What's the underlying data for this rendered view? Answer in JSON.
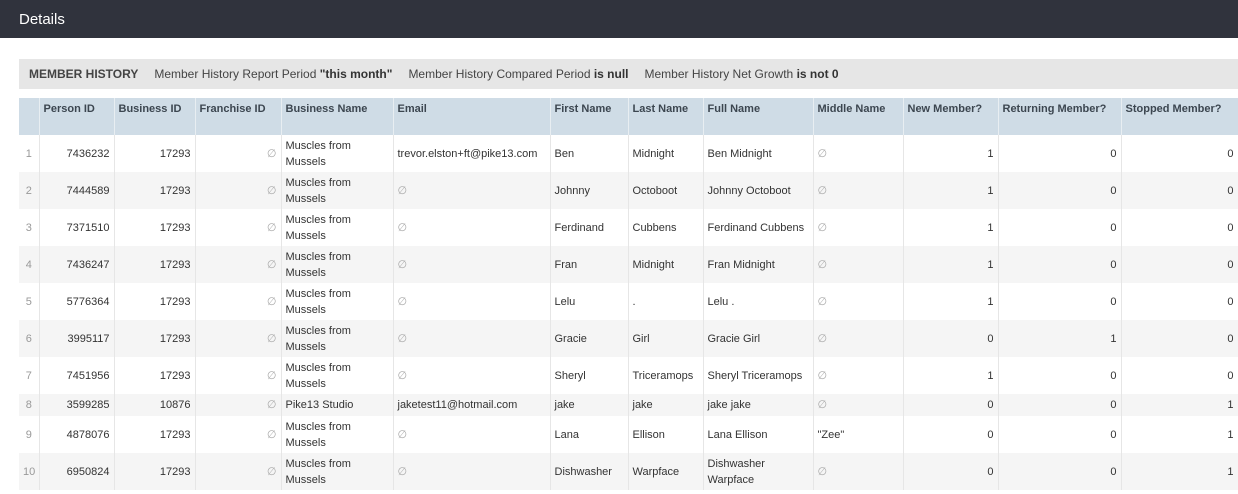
{
  "header": {
    "title": "Details"
  },
  "filters": {
    "title": "MEMBER HISTORY",
    "items": [
      {
        "label": "Member History Report Period ",
        "value": "\"this month\""
      },
      {
        "label": "Member History Compared Period ",
        "value": "is null"
      },
      {
        "label": "Member History Net Growth ",
        "value": "is not 0"
      }
    ]
  },
  "null_symbol": "∅",
  "table": {
    "columns": [
      "",
      "Person ID",
      "Business ID",
      "Franchise ID",
      "Business Name",
      "Email",
      "First Name",
      "Last Name",
      "Full Name",
      "Middle Name",
      "New Member?",
      "Returning Member?",
      "Stopped Member?"
    ],
    "rows": [
      [
        "1",
        "7436232",
        "17293",
        "∅",
        "Muscles from Mussels",
        "trevor.elston+ft@pike13.com",
        "Ben",
        "Midnight",
        "Ben Midnight",
        "∅",
        "1",
        "0",
        "0"
      ],
      [
        "2",
        "7444589",
        "17293",
        "∅",
        "Muscles from Mussels",
        "∅",
        "Johnny",
        "Octoboot",
        "Johnny Octoboot",
        "∅",
        "1",
        "0",
        "0"
      ],
      [
        "3",
        "7371510",
        "17293",
        "∅",
        "Muscles from Mussels",
        "∅",
        "Ferdinand",
        "Cubbens",
        "Ferdinand Cubbens",
        "∅",
        "1",
        "0",
        "0"
      ],
      [
        "4",
        "7436247",
        "17293",
        "∅",
        "Muscles from Mussels",
        "∅",
        "Fran",
        "Midnight",
        "Fran Midnight",
        "∅",
        "1",
        "0",
        "0"
      ],
      [
        "5",
        "5776364",
        "17293",
        "∅",
        "Muscles from Mussels",
        "∅",
        "Lelu",
        ".",
        "Lelu .",
        "∅",
        "1",
        "0",
        "0"
      ],
      [
        "6",
        "3995117",
        "17293",
        "∅",
        "Muscles from Mussels",
        "∅",
        "Gracie",
        "Girl",
        "Gracie Girl",
        "∅",
        "0",
        "1",
        "0"
      ],
      [
        "7",
        "7451956",
        "17293",
        "∅",
        "Muscles from Mussels",
        "∅",
        "Sheryl",
        "Triceramops",
        "Sheryl Triceramops",
        "∅",
        "1",
        "0",
        "0"
      ],
      [
        "8",
        "3599285",
        "10876",
        "∅",
        "Pike13 Studio",
        "jaketest11@hotmail.com",
        "jake",
        "jake",
        "jake jake",
        "∅",
        "0",
        "0",
        "1"
      ],
      [
        "9",
        "4878076",
        "17293",
        "∅",
        "Muscles from Mussels",
        "∅",
        "Lana",
        "Ellison",
        "Lana Ellison",
        "\"Zee\"",
        "0",
        "0",
        "1"
      ],
      [
        "10",
        "6950824",
        "17293",
        "∅",
        "Muscles from Mussels",
        "∅",
        "Dishwasher",
        "Warpface",
        "Dishwasher Warpface",
        "∅",
        "0",
        "0",
        "1"
      ]
    ]
  }
}
